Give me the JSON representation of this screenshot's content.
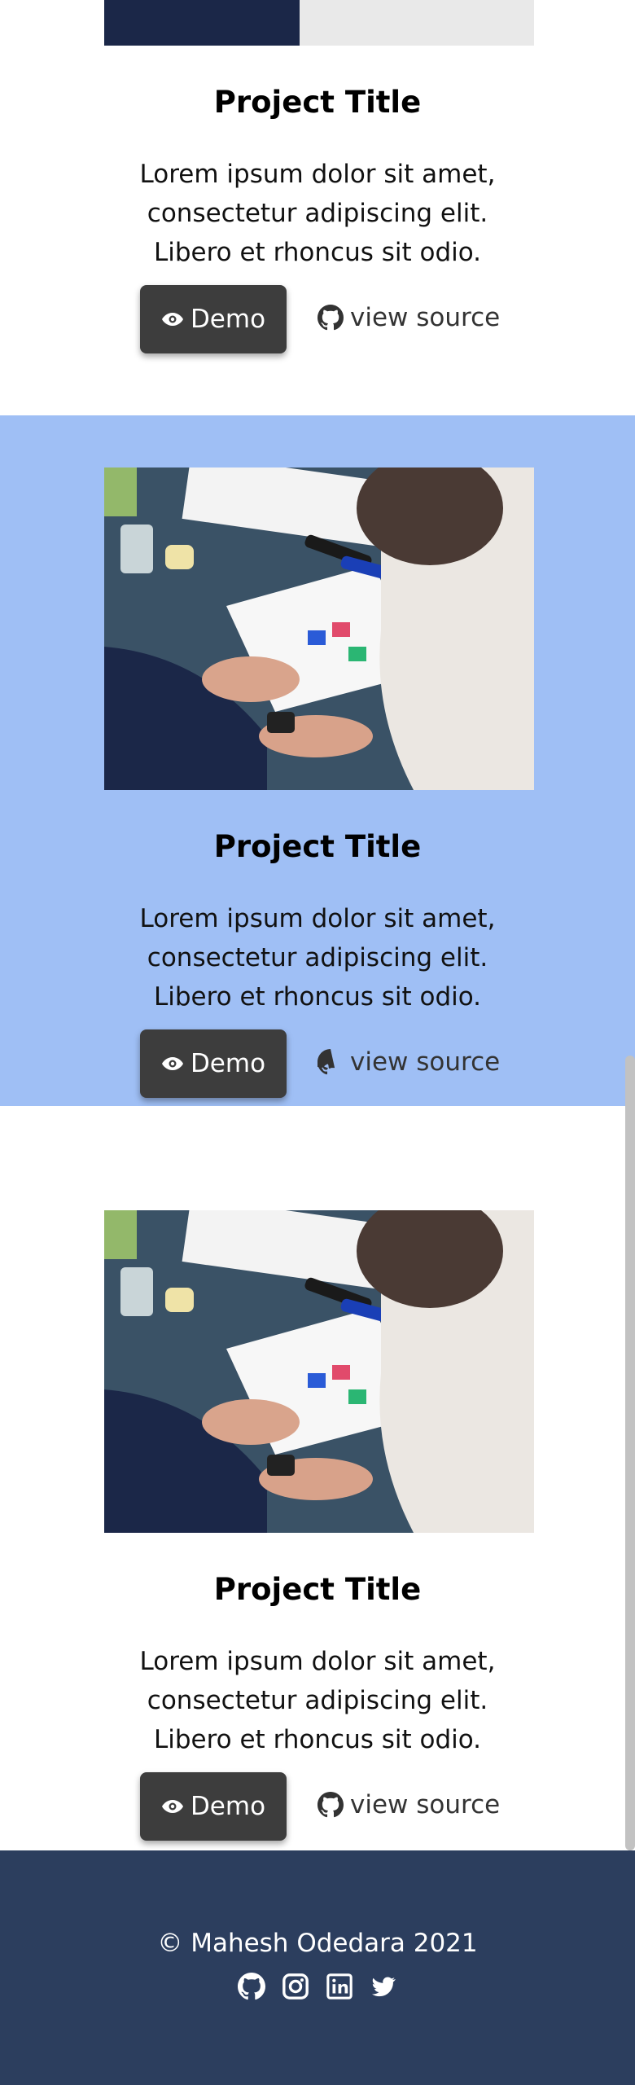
{
  "projects": [
    {
      "title": "Project Title",
      "description": "Lorem ipsum dolor sit amet, consectetur adipiscing elit. Libero et rhoncus sit odio.",
      "demo_label": "Demo",
      "source_label": "view source"
    },
    {
      "title": "Project Title",
      "description": "Lorem ipsum dolor sit amet, consectetur adipiscing elit. Libero et rhoncus sit odio.",
      "demo_label": "Demo",
      "source_label": "view source"
    },
    {
      "title": "Project Title",
      "description": "Lorem ipsum dolor sit amet, consectetur adipiscing elit. Libero et rhoncus sit odio.",
      "demo_label": "Demo",
      "source_label": "view source"
    }
  ],
  "footer": {
    "copyright": "© Mahesh Odedara 2021",
    "social_icons": [
      "github-icon",
      "instagram-icon",
      "linkedin-icon",
      "twitter-icon"
    ]
  },
  "colors": {
    "highlight_section": "#9fbff5",
    "footer_bg": "#2c3e5e",
    "button_bg": "#3d3d3d"
  },
  "icons": {
    "demo": "eye-icon",
    "source": "github-icon"
  }
}
